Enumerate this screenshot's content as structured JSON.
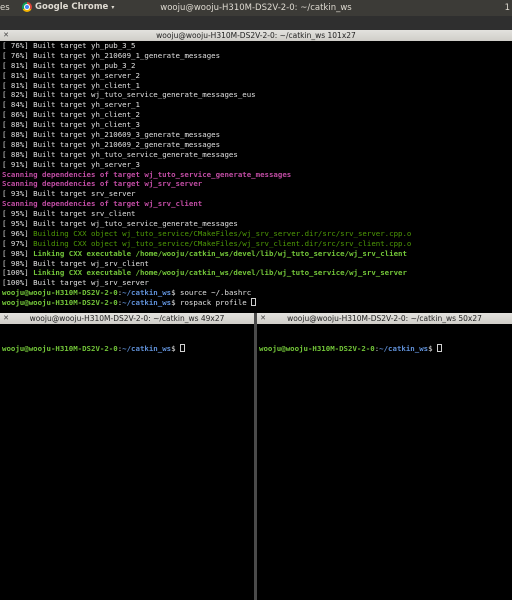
{
  "topbar": {
    "activities": "es",
    "app_name": "Google Chrome",
    "caret": "▾",
    "window_title": "wooju@wooju-H310M-DS2V-2-0: ~/catkin_ws",
    "right": "1"
  },
  "main_terminal": {
    "title": "wooju@wooju-H310M-DS2V-2-0: ~/catkin_ws 101x27",
    "lines": [
      {
        "p": "[ 76%] ",
        "t": "Built target yh_pub_3_5",
        "c": "plain"
      },
      {
        "p": "[ 76%] ",
        "t": "Built target yh_210609_1_generate_messages",
        "c": "plain"
      },
      {
        "p": "[ 81%] ",
        "t": "Built target yh_pub_3_2",
        "c": "plain"
      },
      {
        "p": "[ 81%] ",
        "t": "Built target yh_server_2",
        "c": "plain"
      },
      {
        "p": "[ 81%] ",
        "t": "Built target yh_client_1",
        "c": "plain"
      },
      {
        "p": "[ 82%] ",
        "t": "Built target wj_tuto_service_generate_messages_eus",
        "c": "plain"
      },
      {
        "p": "[ 84%] ",
        "t": "Built target yh_server_1",
        "c": "plain"
      },
      {
        "p": "[ 86%] ",
        "t": "Built target yh_client_2",
        "c": "plain"
      },
      {
        "p": "[ 88%] ",
        "t": "Built target yh_client_3",
        "c": "plain"
      },
      {
        "p": "[ 88%] ",
        "t": "Built target yh_210609_3_generate_messages",
        "c": "plain"
      },
      {
        "p": "[ 88%] ",
        "t": "Built target yh_210609_2_generate_messages",
        "c": "plain"
      },
      {
        "p": "[ 88%] ",
        "t": "Built target yh_tuto_service_generate_messages",
        "c": "plain"
      },
      {
        "p": "[ 91%] ",
        "t": "Built target yh_server_3",
        "c": "plain"
      },
      {
        "p": "",
        "t": "Scanning dependencies of target wj_tuto_service_generate_messages",
        "c": "magenta"
      },
      {
        "p": "",
        "t": "Scanning dependencies of target wj_srv_server",
        "c": "magenta"
      },
      {
        "p": "[ 93%] ",
        "t": "Built target srv_server",
        "c": "plain"
      },
      {
        "p": "",
        "t": "Scanning dependencies of target wj_srv_client",
        "c": "magenta"
      },
      {
        "p": "[ 95%] ",
        "t": "Built target srv_client",
        "c": "plain"
      },
      {
        "p": "[ 95%] ",
        "t": "Built target wj_tuto_service_generate_messages",
        "c": "plain"
      },
      {
        "p": "[ 96%] ",
        "t": "Building CXX object wj_tuto_service/CMakeFiles/wj_srv_server.dir/src/srv_server.cpp.o",
        "c": "green"
      },
      {
        "p": "[ 97%] ",
        "t": "Building CXX object wj_tuto_service/CMakeFiles/wj_srv_client.dir/src/srv_client.cpp.o",
        "c": "green"
      },
      {
        "p": "[ 98%] ",
        "t": "Linking CXX executable /home/wooju/catkin_ws/devel/lib/wj_tuto_service/wj_srv_client",
        "c": "greenbold"
      },
      {
        "p": "[ 98%] ",
        "t": "Built target wj_srv_client",
        "c": "plain"
      },
      {
        "p": "[100%] ",
        "t": "Linking CXX executable /home/wooju/catkin_ws/devel/lib/wj_tuto_service/wj_srv_server",
        "c": "greenbold"
      },
      {
        "p": "[100%] ",
        "t": "Built target wj_srv_server",
        "c": "plain"
      }
    ],
    "prompts": [
      {
        "user": "wooju@wooju-H310M-DS2V-2-0",
        "sep": ":",
        "path": "~/catkin_ws",
        "sym": "$ ",
        "cmd": "source ~/.bashrc",
        "cursor": false
      },
      {
        "user": "wooju@wooju-H310M-DS2V-2-0",
        "sep": ":",
        "path": "~/catkin_ws",
        "sym": "$ ",
        "cmd": "rospack profile ",
        "cursor": true
      }
    ]
  },
  "left_terminal": {
    "title": "wooju@wooju-H310M-DS2V-2-0: ~/catkin_ws 49x27",
    "prompt": {
      "user": "wooju@wooju-H310M-DS2V-2-0",
      "sep": ":",
      "path": "~/catkin_ws",
      "sym": "$ "
    }
  },
  "right_terminal": {
    "title": "wooju@wooju-H310M-DS2V-2-0: ~/catkin_ws 50x27",
    "prompt": {
      "user": "wooju@wooju-H310M-DS2V-2-0",
      "sep": ":",
      "path": "~/catkin_ws",
      "sym": "$ "
    }
  },
  "colors": {
    "plain": "#e0e0e0",
    "green": "#4e9a06",
    "greenbold": "#73c639",
    "magenta": "#c04ca3",
    "path": "#5f8fd6"
  }
}
